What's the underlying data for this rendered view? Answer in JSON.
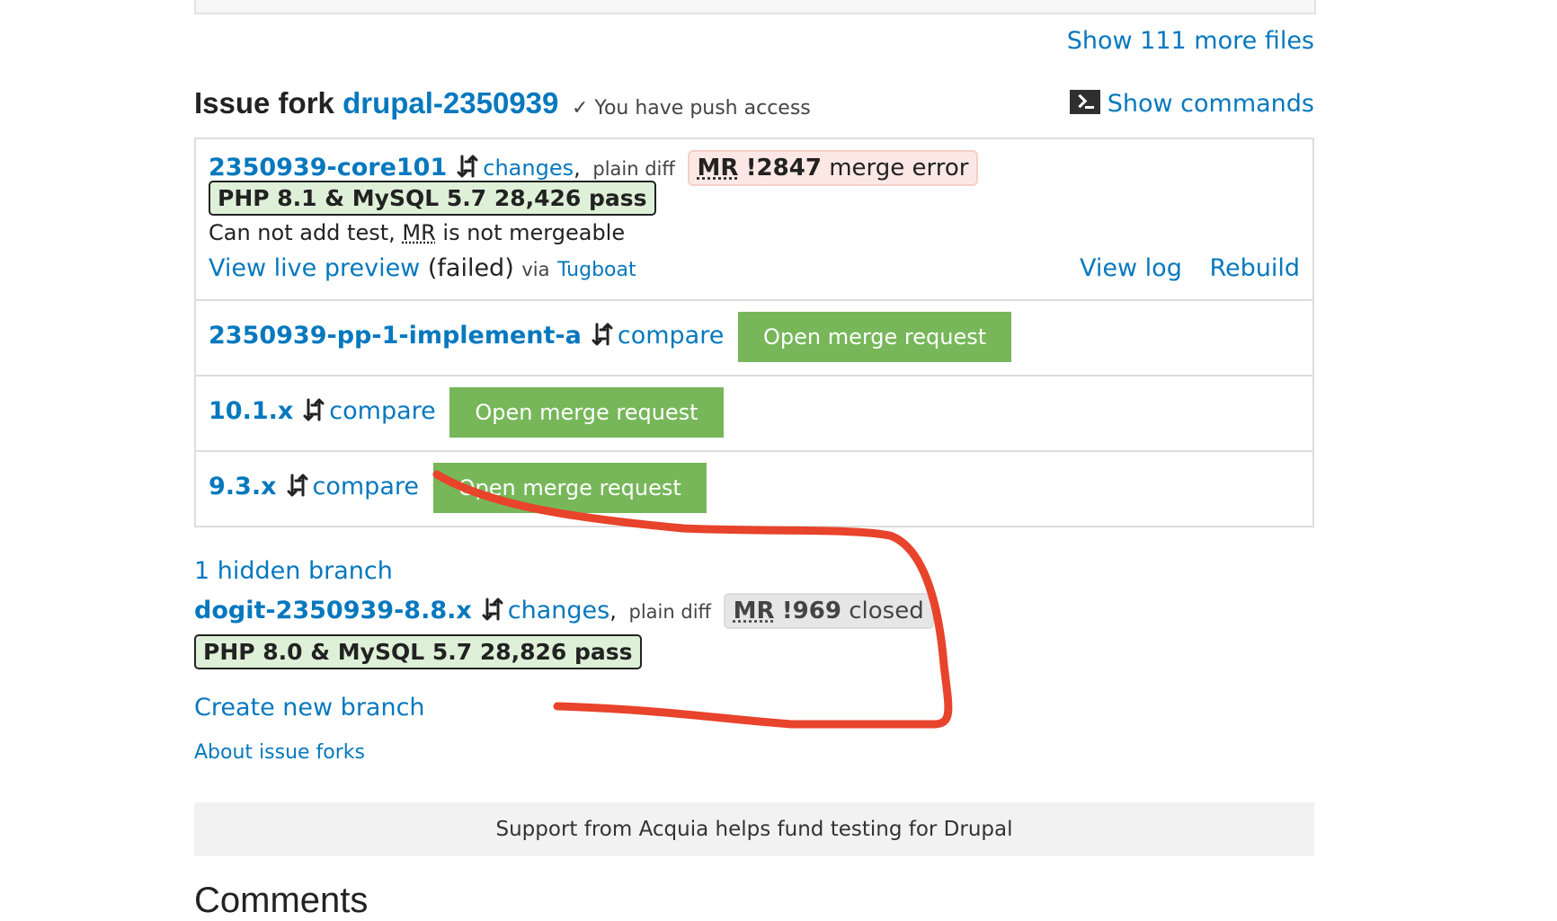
{
  "files": {
    "show_more_label": "Show 111 more files"
  },
  "fork": {
    "title_prefix": "Issue fork ",
    "name": "drupal-2350939",
    "push_access": "✓ You have push access",
    "show_commands_label": "Show commands"
  },
  "branches": [
    {
      "name": "2350939-core101",
      "changes_label": "changes",
      "comma": ",",
      "plain_diff_label": "plain diff",
      "mr_abbr": "MR",
      "mr_number": "!2847",
      "mr_status": "merge error",
      "test_result": "PHP 8.1 & MySQL 5.7 28,426 pass",
      "note_before": "Can not add test, ",
      "note_abbr": "MR",
      "note_after": " is not mergeable",
      "preview_label": "View live preview",
      "preview_status": "(failed)",
      "via_label": "via",
      "tugboat_label": "Tugboat",
      "view_log_label": "View log",
      "rebuild_label": "Rebuild"
    },
    {
      "name": "2350939-pp-1-implement-a",
      "compare_label": "compare",
      "open_mr_label": "Open merge request"
    },
    {
      "name": "10.1.x",
      "compare_label": "compare",
      "open_mr_label": "Open merge request"
    },
    {
      "name": "9.3.x",
      "compare_label": "compare",
      "open_mr_label": "Open merge request"
    }
  ],
  "hidden": {
    "label": "1 hidden branch",
    "name": "dogit-2350939-8.8.x",
    "changes_label": "changes",
    "comma": ",",
    "plain_diff_label": "plain diff",
    "mr_abbr": "MR",
    "mr_number": "!969",
    "mr_status": "closed",
    "test_result": "PHP 8.0 & MySQL 5.7 28,826 pass"
  },
  "actions": {
    "create_branch_label": "Create new branch",
    "about_forks_label": "About issue forks"
  },
  "support_text": "Support from Acquia helps fund testing for Drupal",
  "comments_title": "Comments",
  "colors": {
    "link": "#0678be",
    "open_mr_bg": "#77b75a",
    "test_pass_bg": "#dff0d8",
    "annotation": "#e8432b"
  }
}
